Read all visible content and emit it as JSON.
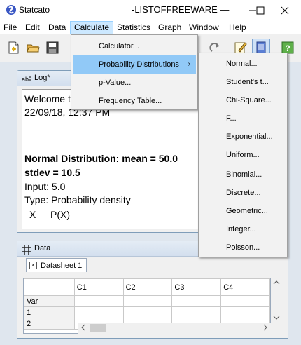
{
  "window": {
    "app_name": "Statcato",
    "title": "-LISTOFFREEWARE —",
    "controls": [
      "—",
      "☐",
      "✕"
    ]
  },
  "menubar": {
    "items": [
      "File",
      "Edit",
      "Data",
      "Calculate",
      "Statistics",
      "Graph",
      "Window",
      "Help"
    ],
    "active": "Calculate"
  },
  "calculate_menu": {
    "items": [
      "Calculator...",
      "Probability Distributions",
      "p-Value...",
      "Frequency Table..."
    ],
    "highlighted": "Probability Distributions",
    "submenu_arrow": "›"
  },
  "prob_submenu": {
    "group1": [
      "Normal...",
      "Student's t...",
      "Chi-Square...",
      "F...",
      "Exponential...",
      "Uniform..."
    ],
    "group2": [
      "Binomial...",
      "Discrete...",
      "Geometric...",
      "Integer...",
      "Poisson..."
    ]
  },
  "log": {
    "title": "Log*",
    "welcome": "Welcome t",
    "timestamp": "22/09/18, 12:37 PM",
    "result_line1": "Normal Distribution: mean = 50.0",
    "result_line2": "stdev = 10.5",
    "input": "Input: 5.0",
    "type": "Type: Probability density",
    "header_x": "X",
    "header_px": "P(X)"
  },
  "data_window": {
    "title": "Data",
    "tab_label": "Datasheet",
    "tab_number": "1",
    "columns": [
      "C1",
      "C2",
      "C3",
      "C4"
    ],
    "rows": [
      "Var",
      "1",
      "2"
    ]
  }
}
